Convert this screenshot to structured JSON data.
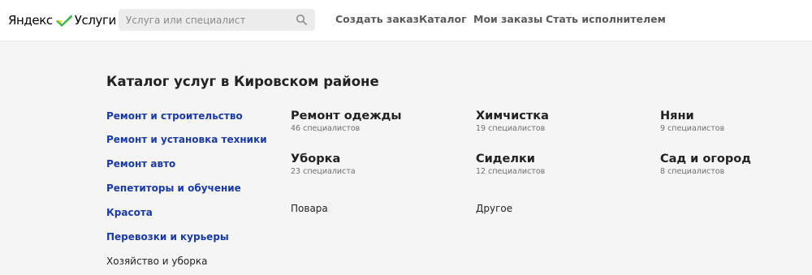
{
  "header": {
    "logo": {
      "yandex": "Яндекс",
      "services": "Услуги"
    },
    "search": {
      "placeholder": "Услуга или специалист"
    },
    "nav": [
      {
        "label": "Создать заказ"
      },
      {
        "label": "Каталог"
      },
      {
        "label": "Мои заказы"
      },
      {
        "label": "Стать исполнителем"
      }
    ],
    "colors": {
      "logo_check_green": "#35b83f",
      "logo_check_yellow": "#ffd83b"
    }
  },
  "main": {
    "title": "Каталог услуг в Кировском районе",
    "sidebar": [
      {
        "label": "Ремонт и строительство"
      },
      {
        "label": "Ремонт и установка техники"
      },
      {
        "label": "Ремонт авто"
      },
      {
        "label": "Репетиторы и обучение"
      },
      {
        "label": "Красота"
      },
      {
        "label": "Перевозки и курьеры"
      },
      {
        "label": "Хозяйство и уборка"
      }
    ],
    "categories": [
      {
        "title": "Ремонт одежды",
        "count": "46 специалистов"
      },
      {
        "title": "Химчистка",
        "count": "19 специалистов"
      },
      {
        "title": "Няни",
        "count": "9 специалистов"
      },
      {
        "title": "Уборка",
        "count": "23 специалиста"
      },
      {
        "title": "Сиделки",
        "count": "12 специалистов"
      },
      {
        "title": "Сад и огород",
        "count": "8 специалистов"
      }
    ],
    "other": [
      {
        "label": "Повара"
      },
      {
        "label": "Другое"
      }
    ],
    "colors": {
      "link_blue": "#1a3aa6",
      "background": "#f5f5f5"
    }
  }
}
